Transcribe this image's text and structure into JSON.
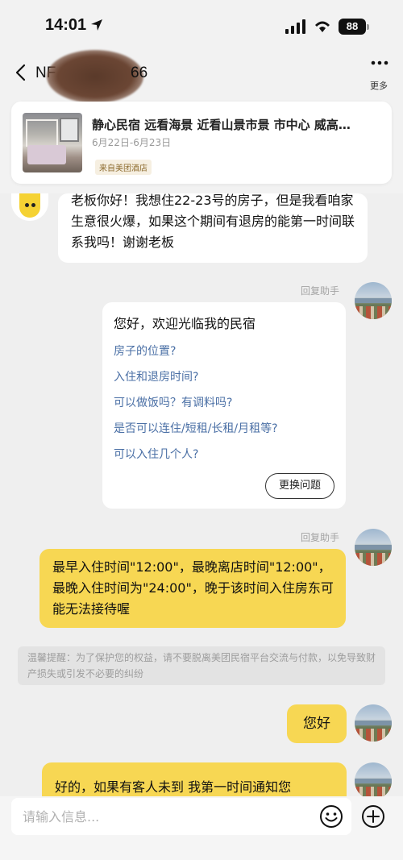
{
  "status_bar": {
    "time": "14:01",
    "battery": "88"
  },
  "header": {
    "contact_name_prefix": "NF",
    "contact_name_suffix": "66",
    "more_label": "更多"
  },
  "order_card": {
    "title": "静心民宿 远看海景 近看山景市景 市中心 威高…",
    "date_range": "6月22日-6月23日",
    "source": "来自美团酒店"
  },
  "messages": {
    "guest_1": "老板你好！我想住22-23号的房子，但是我看咱家生意很火爆，如果这个期间有退房的能第一时间联系我吗！谢谢老板",
    "reply_tag_1": "回复助手",
    "qa": {
      "greeting": "您好，欢迎光临我的民宿",
      "questions": [
        "房子的位置?",
        "入住和退房时间?",
        "可以做饭吗？有调料吗?",
        "是否可以连住/短租/长租/月租等?",
        "可以入住几个人?"
      ],
      "change_button": "更换问题"
    },
    "reply_tag_2": "回复助手",
    "host_2": "最早入住时间\"12:00\"，最晚离店时间\"12:00\"，最晚入住时间为\"24:00\"，晚于该时间入住房东可能无法接待喔",
    "notice": "温馨提醒：为了保护您的权益，请不要脱离美团民宿平台交流与付款，以免导致财产损失或引发不必要的纠纷",
    "host_3": "您好",
    "host_4": "好的，如果有客人未到 我第一时间通知您"
  },
  "input": {
    "placeholder": "请输入信息...",
    "value": ""
  },
  "icons": {
    "back": "chevron-left-icon",
    "more": "ellipsis-icon",
    "emoji": "smile-icon",
    "plus": "plus-circle-icon"
  },
  "colors": {
    "host_bubble": "#f7d753",
    "link": "#4a6fa5",
    "background": "#efefef"
  }
}
